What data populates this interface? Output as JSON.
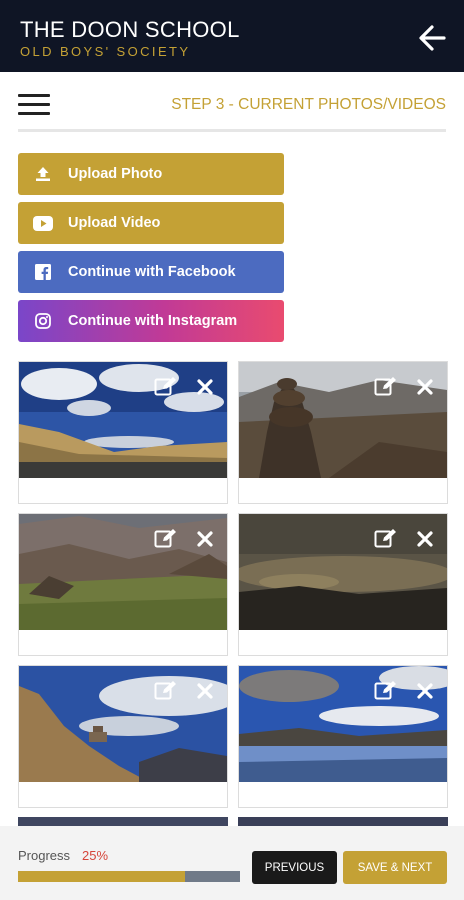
{
  "header": {
    "title": "THE DOON SCHOOL",
    "subtitle": "OLD BOYS' SOCIETY",
    "back_icon": "back-arrow-icon",
    "background_color": "#0f1525",
    "subtitle_color": "#c4a135"
  },
  "toolbar": {
    "menu_icon": "hamburger-menu-icon",
    "step_title": "STEP 3 - CURRENT PHOTOS/VIDEOS"
  },
  "actions": [
    {
      "label": "Upload Photo",
      "icon": "upload-icon",
      "color": "#c4a135"
    },
    {
      "label": "Upload Video",
      "icon": "youtube-icon",
      "color": "#c4a135"
    },
    {
      "label": "Continue with Facebook",
      "icon": "facebook-icon",
      "color": "#4c6bc0"
    },
    {
      "label": "Continue with Instagram",
      "icon": "instagram-icon",
      "color": "#c13a96"
    }
  ],
  "gallery": {
    "item_icons": [
      "edit-icon",
      "delete-icon"
    ],
    "photos": [
      {
        "scene": "mountain-valley-clouds"
      },
      {
        "scene": "rock-cairn-mountains"
      },
      {
        "scene": "green-valley-mountains"
      },
      {
        "scene": "dark-stormy-sky"
      },
      {
        "scene": "monastery-on-hill"
      },
      {
        "scene": "river-reflection"
      }
    ]
  },
  "footer": {
    "progress_label": "Progress",
    "progress_value": "25%",
    "progress_fraction": 0.75,
    "previous_label": "PREVIOUS",
    "next_label": "SAVE & NEXT",
    "accent_color": "#c4a135",
    "percent_color": "#d6453a"
  }
}
